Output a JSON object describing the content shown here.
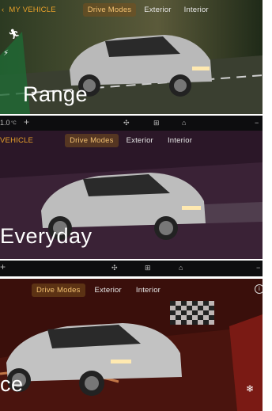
{
  "panels": [
    {
      "vehicle_label": "MY VEHICLE",
      "tabs": [
        "Drive Modes",
        "Exterior",
        "Interior"
      ],
      "active_tab": "Drive Modes",
      "mode_label": "Range",
      "accent": "#e8a12a"
    },
    {
      "vehicle_label": "VEHICLE",
      "tabs": [
        "Drive Modes",
        "Exterior",
        "Interior"
      ],
      "active_tab": "Drive Modes",
      "mode_label": "Everyday",
      "accent": "#e8a12a"
    },
    {
      "tabs": [
        "Drive Modes",
        "Exterior",
        "Interior"
      ],
      "active_tab": "Drive Modes",
      "mode_label": "ce",
      "accent": "#e8a12a"
    }
  ],
  "strips": [
    {
      "temp": "1.0",
      "temp_unit": "°C",
      "plus": "+",
      "fan_icon": "fan-icon",
      "grid_icon": "grid-icon",
      "home_icon": "home-icon",
      "minus": "−"
    },
    {
      "plus": "+",
      "fan_icon": "fan-icon",
      "grid_icon": "grid-icon",
      "home_icon": "home-icon",
      "minus": "−"
    }
  ],
  "icons": {
    "sport_icon": "running-figure-icon",
    "eco_icon": "leaf-icon",
    "info_icon": "info-icon",
    "snowflake_icon": "snowflake-icon",
    "back_icon": "chevron-left-icon"
  }
}
